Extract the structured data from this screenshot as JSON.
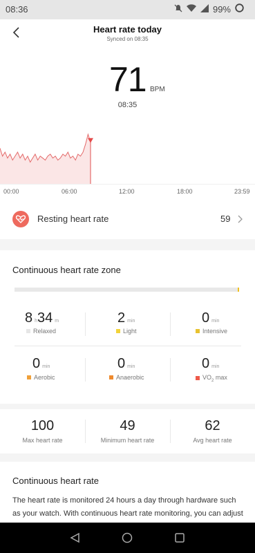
{
  "status_bar": {
    "time": "08:36",
    "battery": "99%"
  },
  "header": {
    "title": "Heart rate today",
    "subtitle": "Synced on 08:35"
  },
  "current": {
    "value": "71",
    "unit": "BPM",
    "time": "08:35"
  },
  "chart_data": {
    "type": "area",
    "x_ticks": [
      "00:00",
      "06:00",
      "12:00",
      "18:00",
      "23:59"
    ],
    "series": [
      {
        "values": [
          68,
          64,
          66,
          63,
          65,
          62,
          64,
          66,
          63,
          65,
          62,
          64,
          61,
          63,
          65,
          62,
          64,
          63,
          62,
          64,
          65,
          63,
          64,
          62,
          63,
          65,
          64,
          66,
          63,
          64,
          62,
          65,
          64,
          66,
          70,
          75,
          71
        ]
      }
    ],
    "colors": {
      "line": "#e46a6a",
      "fill": "#fbe6e6",
      "marker": "#e44a4a"
    }
  },
  "resting": {
    "label": "Resting heart rate",
    "value": "59"
  },
  "zone": {
    "title": "Continuous heart rate zone",
    "items": [
      {
        "num1": "8",
        "unit1": "h",
        "num2": "34",
        "unit2": "m",
        "label": "Relaxed",
        "color": "#e6e6e6"
      },
      {
        "num1": "2",
        "unit1": "min",
        "label": "Light",
        "color": "#f2d33a"
      },
      {
        "num1": "0",
        "unit1": "min",
        "label": "Intensive",
        "color": "#e8c230"
      },
      {
        "num1": "0",
        "unit1": "min",
        "label": "Aerobic",
        "color": "#f0a03a"
      },
      {
        "num1": "0",
        "unit1": "min",
        "label": "Anaerobic",
        "color": "#ee8a2e"
      },
      {
        "num1": "0",
        "unit1": "min",
        "label": "VO",
        "label_sub": "2",
        "label_tail": " max",
        "color": "#ee5a4a"
      }
    ],
    "bar_fill_fraction": 0.99
  },
  "stats": [
    {
      "value": "100",
      "label": "Max heart rate"
    },
    {
      "value": "49",
      "label": "Minimum heart rate"
    },
    {
      "value": "62",
      "label": "Avg heart rate"
    }
  ],
  "continuous": {
    "title": "Continuous heart rate",
    "text": "The heart rate is monitored 24 hours a day through hardware such as your watch. With continuous heart rate monitoring, you can adjust"
  }
}
